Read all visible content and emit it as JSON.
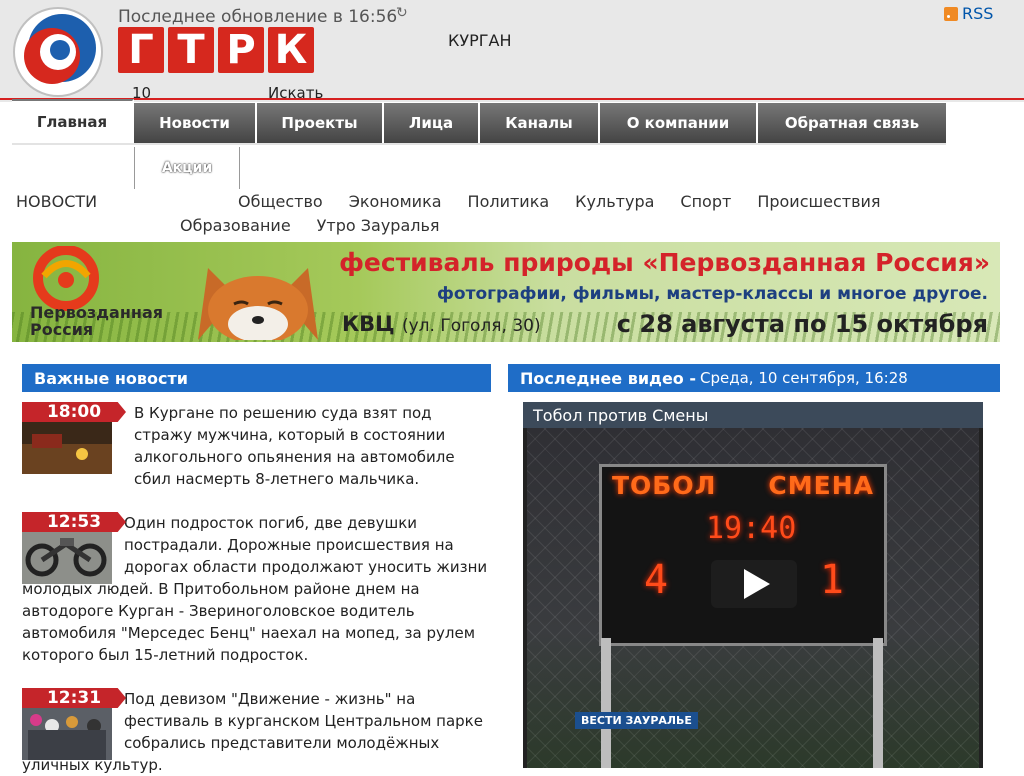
{
  "header": {
    "update_label": "Последнее обновление в 16:56",
    "brand_letters": [
      "Г",
      "Т",
      "Р",
      "К"
    ],
    "channel_number": "10",
    "search_label": "Искать",
    "city": "КУРГАН",
    "rss_label": "RSS"
  },
  "nav": {
    "items": [
      {
        "label": "Главная",
        "active": true
      },
      {
        "label": "Новости"
      },
      {
        "label": "Проекты"
      },
      {
        "label": "Лица"
      },
      {
        "label": "Каналы"
      },
      {
        "label": "О компании"
      },
      {
        "label": "Обратная связь"
      }
    ],
    "sub_item": "Акции"
  },
  "categories": {
    "label": "НОВОСТИ",
    "items": [
      "Общество",
      "Экономика",
      "Политика",
      "Культура",
      "Спорт",
      "Происшествия",
      "Образование",
      "Утро Зауралья"
    ]
  },
  "banner": {
    "logo_text_1": "Первозданная",
    "logo_text_2": "Россия",
    "title": "фестиваль природы «Первозданная Россия»",
    "subtitle": "фотографии, фильмы, мастер-классы и многое другое.",
    "place": "КВЦ",
    "address": "(ул. Гоголя, 30)",
    "dates": "с 28 августа по 15 октября"
  },
  "news": {
    "heading": "Важные новости",
    "items": [
      {
        "time": "18:00",
        "text": "В Кургане по решению суда взят под стражу мужчина, который в состоянии алкогольного опьянения на автомобиле сбил насмерть 8-летнего мальчика."
      },
      {
        "time": "12:53",
        "text": "Один подросток погиб, две девушки пострадали. Дорожные происшествия на дорогах области продолжают уносить жизни молодых людей. В Притобольном районе днем на автодороге Курган - Звериноголовское водитель автомобиля \"Мерседес Бенц\" наехал на мопед, за рулем которого был 15-летний подросток."
      },
      {
        "time": "12:31",
        "text": "Под девизом \"Движение - жизнь\" на фестиваль в курганском Центральном парке собрались представители молодёжных уличных культур."
      }
    ]
  },
  "video": {
    "heading": "Последнее видео -",
    "date": "Среда, 10 сентября, 16:28",
    "title": "Тобол против Смены",
    "team_left": "ТОБОЛ",
    "team_right": "СМЕНА",
    "clock": "19:40",
    "score_left": "4",
    "score_right": "1",
    "watermark": "ВЕСТИ ЗАУРАЛЬЕ"
  },
  "colors": {
    "accent_blue": "#1f6dc7",
    "accent_red": "#c5252a",
    "nav_dark": "#444444"
  }
}
